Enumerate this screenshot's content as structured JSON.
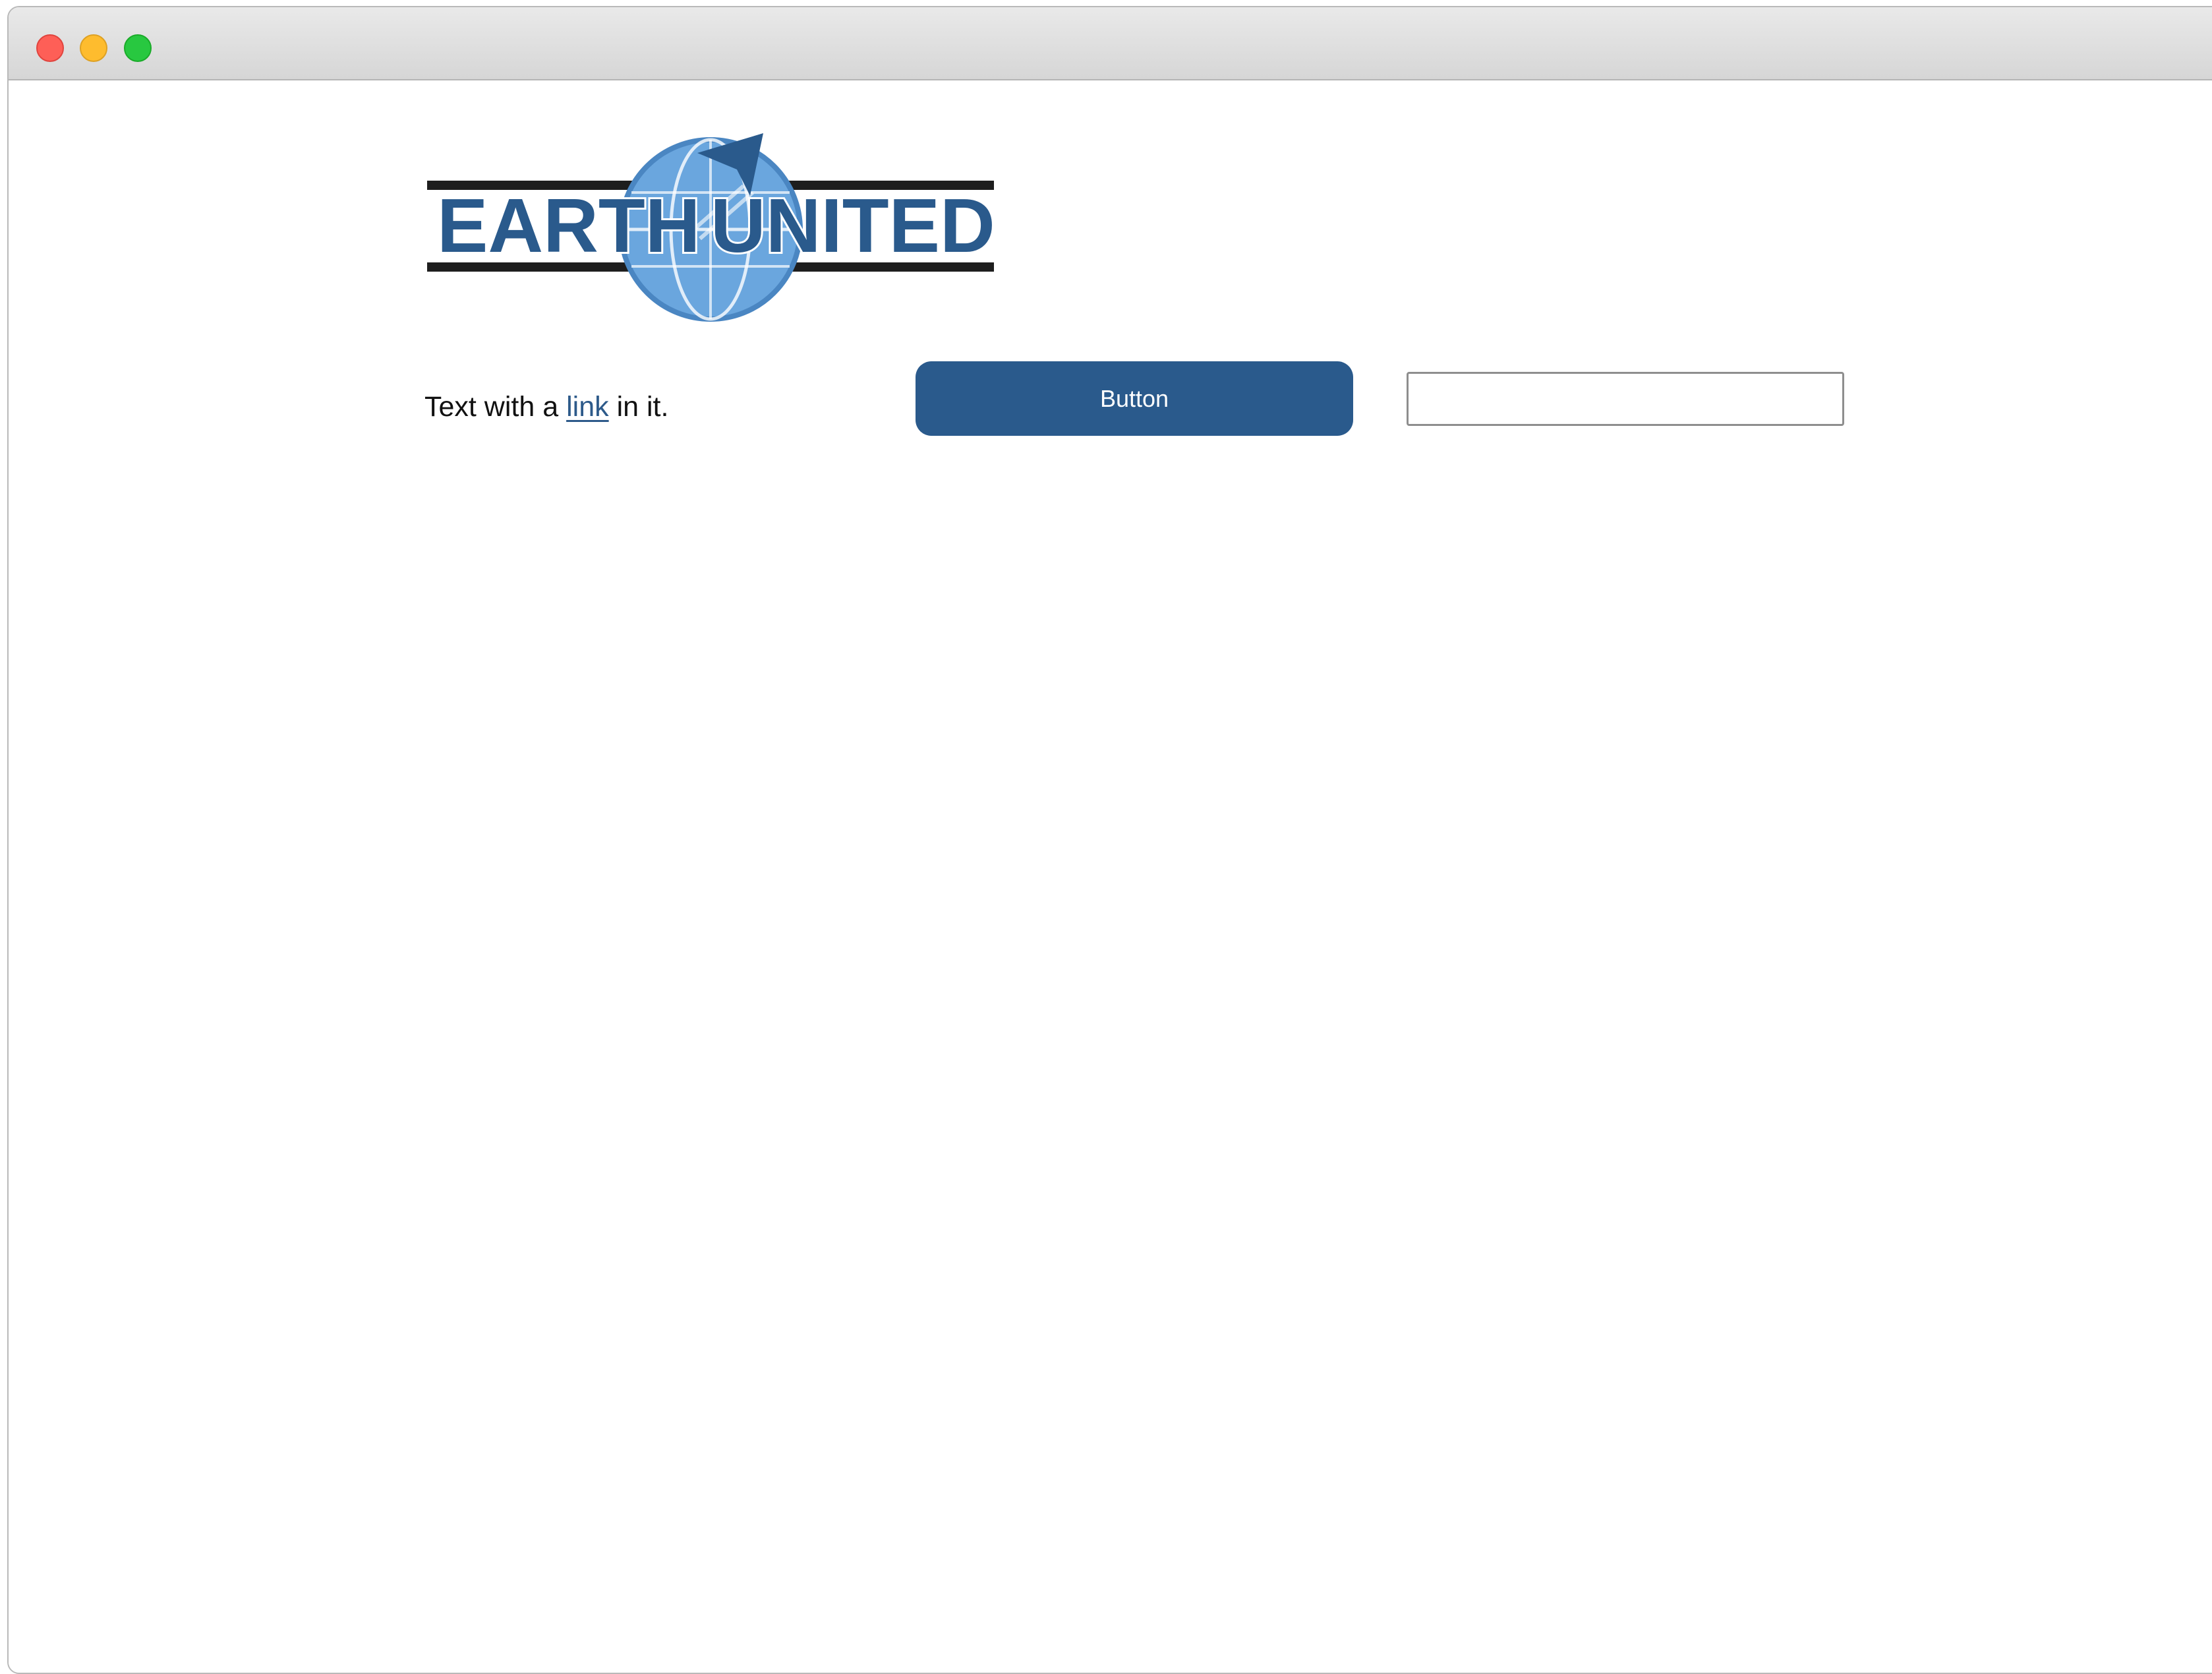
{
  "window": {
    "controls": {
      "close_icon": "close-traffic-light",
      "minimize_icon": "minimize-traffic-light",
      "maximize_icon": "maximize-traffic-light"
    }
  },
  "logo": {
    "text_left": "EARTH",
    "text_right": "UNITED",
    "colors": {
      "brand_blue": "#2a5a8c",
      "globe_blue": "#6aa6de",
      "stripe": "#1e1e1e"
    }
  },
  "main": {
    "text_before": "Text with a ",
    "link_label": "link",
    "text_after": " in it.",
    "button_label": "Button",
    "input_value": ""
  },
  "colors": {
    "button_bg": "#2a5a8c",
    "link": "#2d5a8a"
  }
}
